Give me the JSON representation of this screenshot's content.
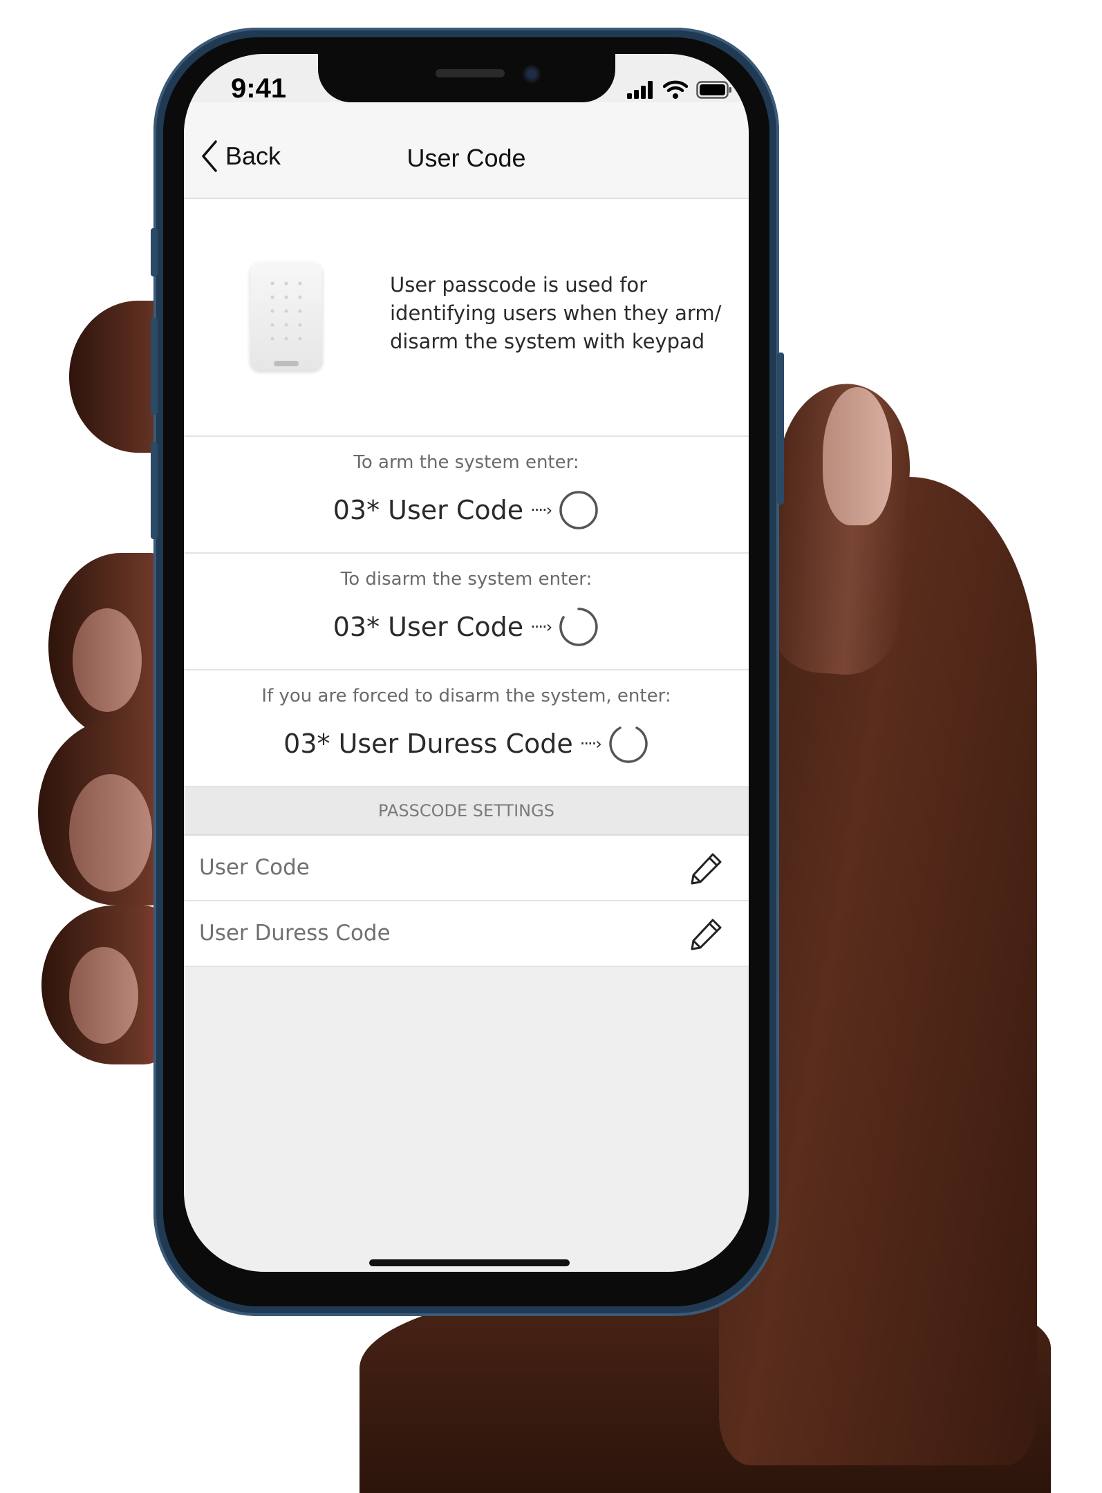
{
  "status_bar": {
    "time": "9:41"
  },
  "nav": {
    "back_label": "Back",
    "title": "User Code"
  },
  "intro": {
    "line1": "User passcode is used for",
    "line2": "identifying users when they arm/",
    "line3": "disarm the system with keypad"
  },
  "code_blocks": [
    {
      "caption": "To arm the system enter:",
      "code": "03* User Code",
      "arrow": "····›"
    },
    {
      "caption": "To disarm the system enter:",
      "code": "03* User Code",
      "arrow": "····›"
    },
    {
      "caption": "If you are forced to disarm the system, enter:",
      "code": "03* User Duress Code",
      "arrow": "····›"
    }
  ],
  "passcode_settings": {
    "header": "PASSCODE SETTINGS",
    "rows": [
      {
        "label": "User Code"
      },
      {
        "label": "User Duress Code"
      }
    ]
  },
  "icons": {
    "back": "chevron-left-icon",
    "edit": "pencil-icon",
    "arm": "circle-icon",
    "disarm": "open-circle-icon",
    "duress": "open-circle-icon",
    "signal": "cellular-signal-icon",
    "wifi": "wifi-icon",
    "battery": "battery-icon"
  }
}
